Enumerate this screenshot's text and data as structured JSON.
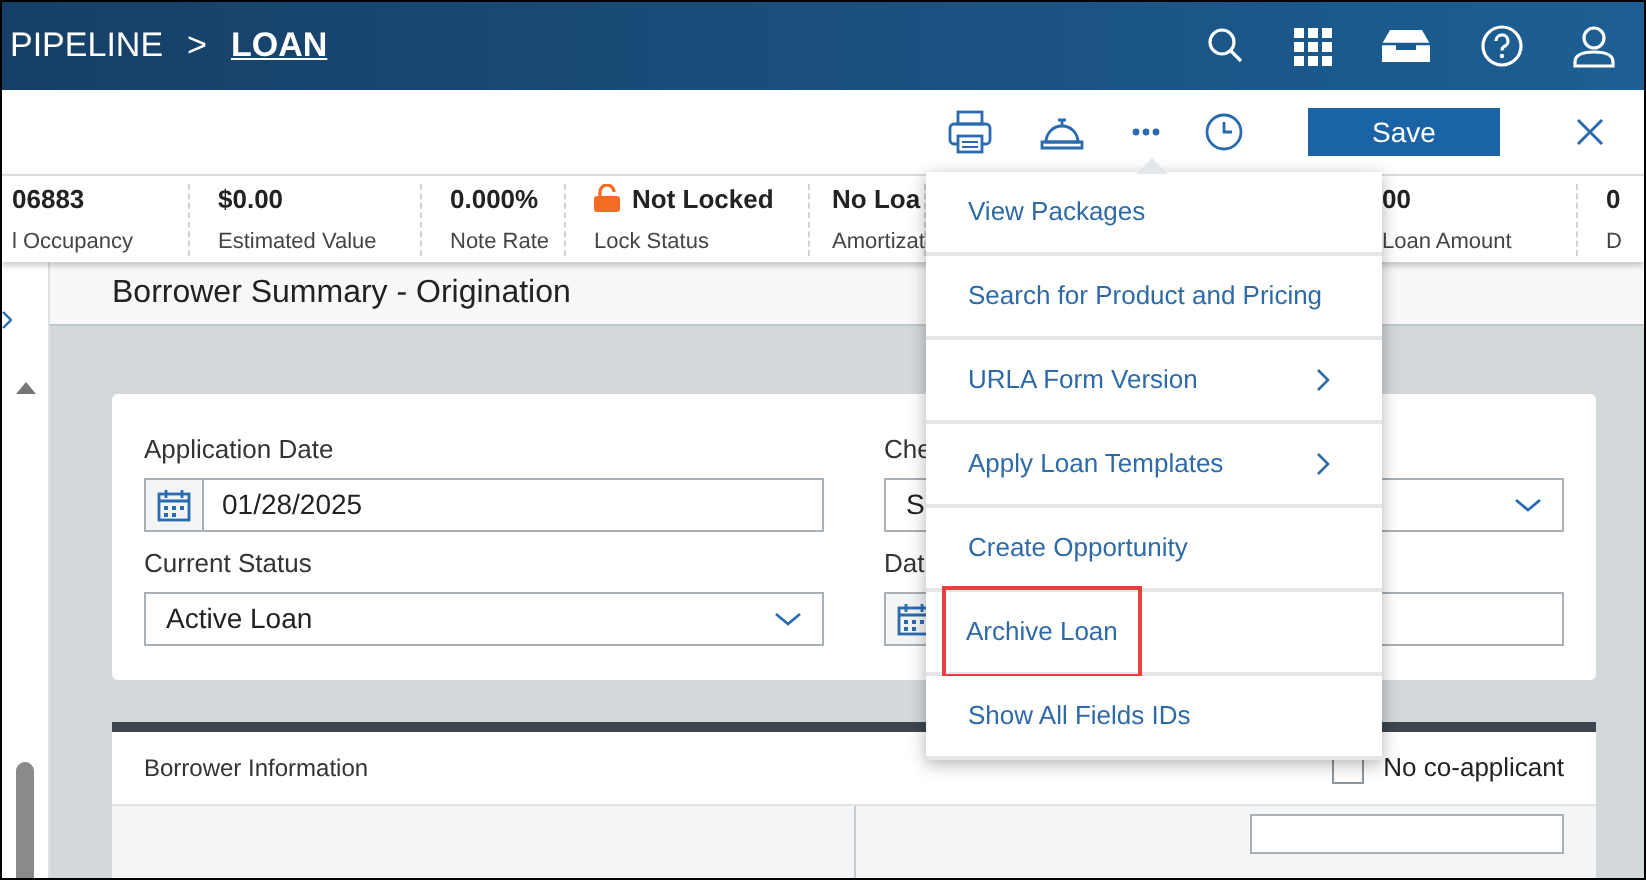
{
  "header": {
    "breadcrumb": [
      {
        "label": "PIPELINE",
        "current": false
      },
      {
        "label": "LOAN",
        "current": true
      }
    ],
    "separator": ">"
  },
  "toolbar": {
    "save_label": "Save"
  },
  "summary": [
    {
      "value": "06883",
      "label": "l Occupancy",
      "kind": "plain"
    },
    {
      "value": "$0.00",
      "label": "Estimated Value",
      "kind": "plain"
    },
    {
      "value": "0.000%",
      "label": "Note Rate",
      "kind": "plain"
    },
    {
      "value": "Not Locked",
      "label": "Lock Status",
      "kind": "lock"
    },
    {
      "value": "No Loa",
      "label": "Amortizat",
      "kind": "plain"
    },
    {
      "value": "00",
      "label": "Loan Amount",
      "kind": "plain"
    },
    {
      "value": "0",
      "label": "D",
      "kind": "plain"
    }
  ],
  "section_title": "Borrower Summary - Origination",
  "form": {
    "left": [
      {
        "label": "Application Date",
        "kind": "date",
        "value": "01/28/2025"
      },
      {
        "label": "Current Status",
        "kind": "select",
        "value": "Active Loan"
      }
    ],
    "right": [
      {
        "label": "Che",
        "kind": "select",
        "value": "S"
      },
      {
        "label": "Dat",
        "kind": "date"
      }
    ]
  },
  "borrower_info": {
    "title": "Borrower Information",
    "no_coapplicant": {
      "label": "No co-applicant",
      "checked": false
    }
  },
  "menu": [
    {
      "label": "View Packages",
      "submenu": false,
      "highlighted": false
    },
    {
      "label": "Search for Product and Pricing",
      "submenu": false,
      "highlighted": false
    },
    {
      "label": "URLA Form Version",
      "submenu": true,
      "highlighted": false
    },
    {
      "label": "Apply Loan Templates",
      "submenu": true,
      "highlighted": false
    },
    {
      "label": "Create Opportunity",
      "submenu": false,
      "highlighted": false
    },
    {
      "label": "Archive Loan",
      "submenu": false,
      "highlighted": true
    },
    {
      "label": "Show All Fields IDs",
      "submenu": false,
      "highlighted": false
    }
  ]
}
